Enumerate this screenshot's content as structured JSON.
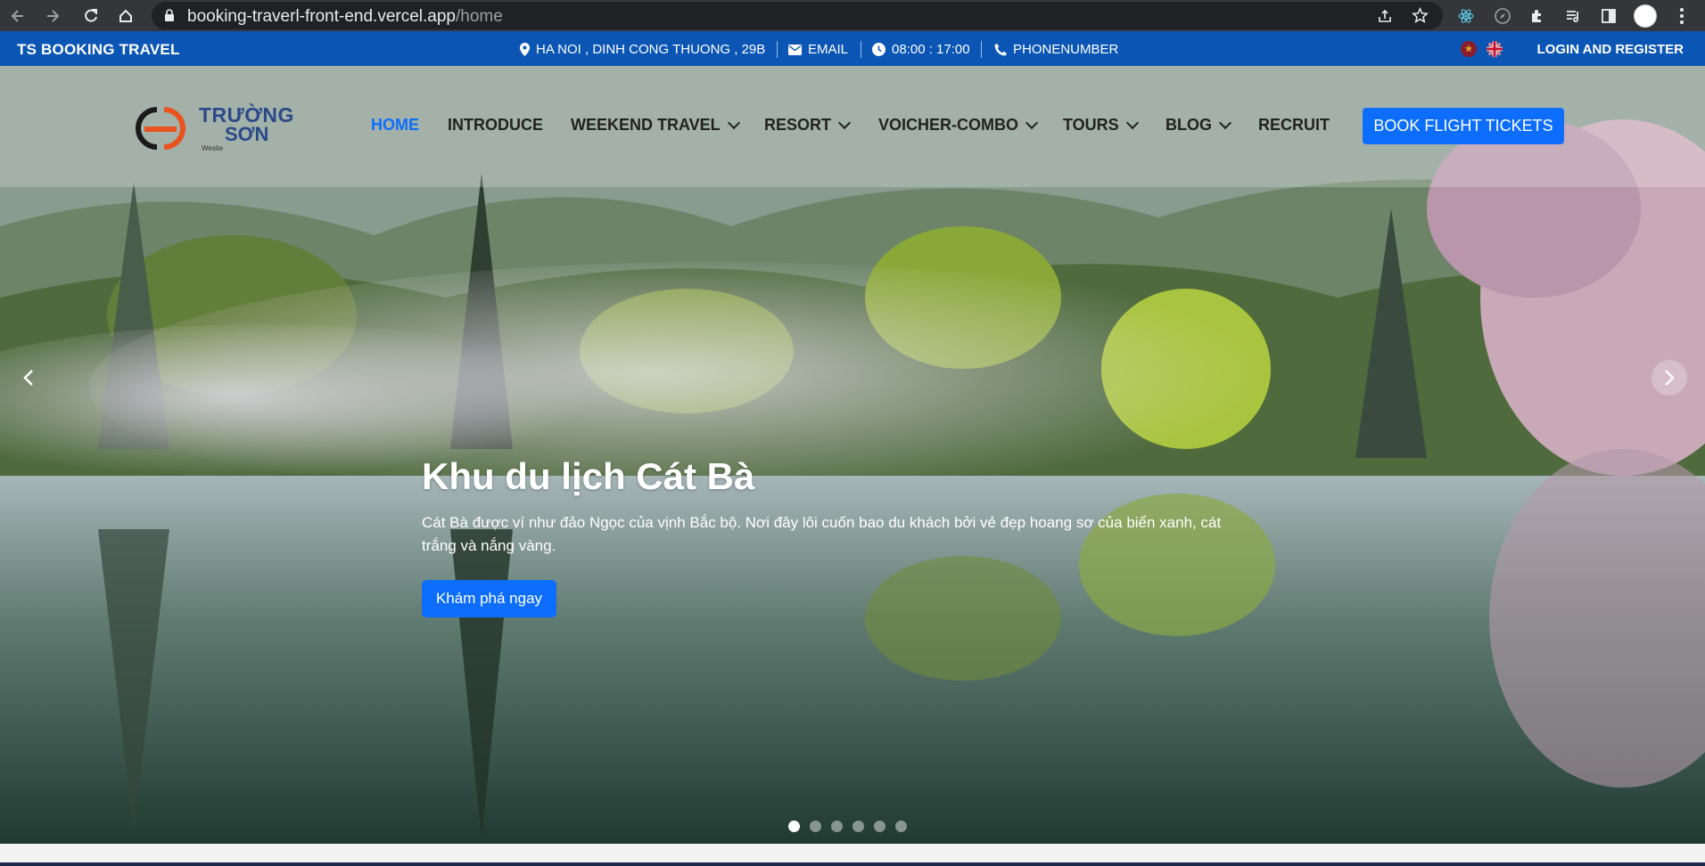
{
  "browser": {
    "url_host": "booking-traverl-front-end.vercel.app",
    "url_path": "/home"
  },
  "topbar": {
    "brand": "TS BOOKING TRAVEL",
    "address": "HA NOI , DINH CONG THUONG , 29B",
    "email": "EMAIL",
    "hours": "08:00 : 17:00",
    "phone": "PHONENUMBER",
    "login": "LOGIN AND REGISTER"
  },
  "logo": {
    "line1": "TRƯỜNG",
    "line2": "SƠN",
    "tag": "Wesite"
  },
  "nav": {
    "home": "HOME",
    "introduce": "INTRODUCE",
    "weekend": "WEEKEND TRAVEL",
    "resort": "RESORT",
    "voucher": "VOICHER-COMBO",
    "tours": "TOURS",
    "blog": "BLOG",
    "recruit": "RECRUIT",
    "book": "BOOK FLIGHT TICKETS"
  },
  "hero": {
    "title": "Khu du lịch Cát Bà",
    "description": "Cát Bà được ví như đảo Ngọc của vịnh Bắc bộ. Nơi đây lôi cuốn bao du khách bởi vẻ đẹp hoang sơ của biển xanh, cát trắng và nắng vàng.",
    "cta": "Khám phá ngay",
    "slide_count": 6,
    "active_slide": 1
  },
  "colors": {
    "topbar": "#0b56b4",
    "accent": "#0d6efd"
  }
}
